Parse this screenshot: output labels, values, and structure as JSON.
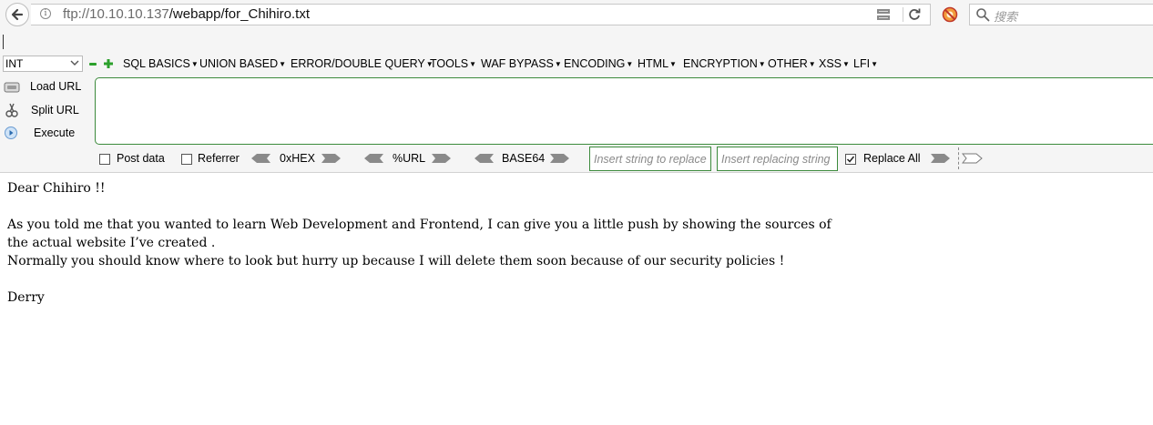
{
  "navbar": {
    "url_host": "ftp://10.10.10.137",
    "url_path": "/webapp/for_Chihiro.txt",
    "search_placeholder": "搜索",
    "icons": [
      "back-arrow-icon",
      "info-icon",
      "reader-view-icon",
      "reload-icon",
      "addon-icon",
      "search-icon"
    ]
  },
  "hackbar": {
    "type_select": "INT",
    "menus": [
      "SQL BASICS",
      "UNION BASED",
      "ERROR/DOUBLE QUERY",
      "TOOLS",
      "WAF BYPASS",
      "ENCODING",
      "HTML",
      "ENCRYPTION",
      "OTHER",
      "XSS",
      "LFI"
    ],
    "side_buttons": {
      "load_url": "Load URL",
      "split_url": "Split URL",
      "execute": "Execute"
    },
    "textarea_value": "",
    "options": {
      "post_data": "Post data",
      "referrer": "Referrer",
      "hex": "0xHEX",
      "url": "%URL",
      "base64": "BASE64",
      "replace_placeholder": "Insert string to replace",
      "replacing_placeholder": "Insert replacing string",
      "replace_all": "Replace All",
      "replace_all_checked": true
    },
    "accent_color": "#3c8a3c"
  },
  "content": {
    "lines": [
      "Dear Chihiro !!",
      "",
      "As you told me that you wanted to learn Web Development and Frontend, I can give you a little push by showing the sources of",
      "the actual website I’ve created .",
      "Normally you should know where to look but hurry up because I will delete them soon because of our security policies !",
      "",
      "Derry"
    ]
  }
}
